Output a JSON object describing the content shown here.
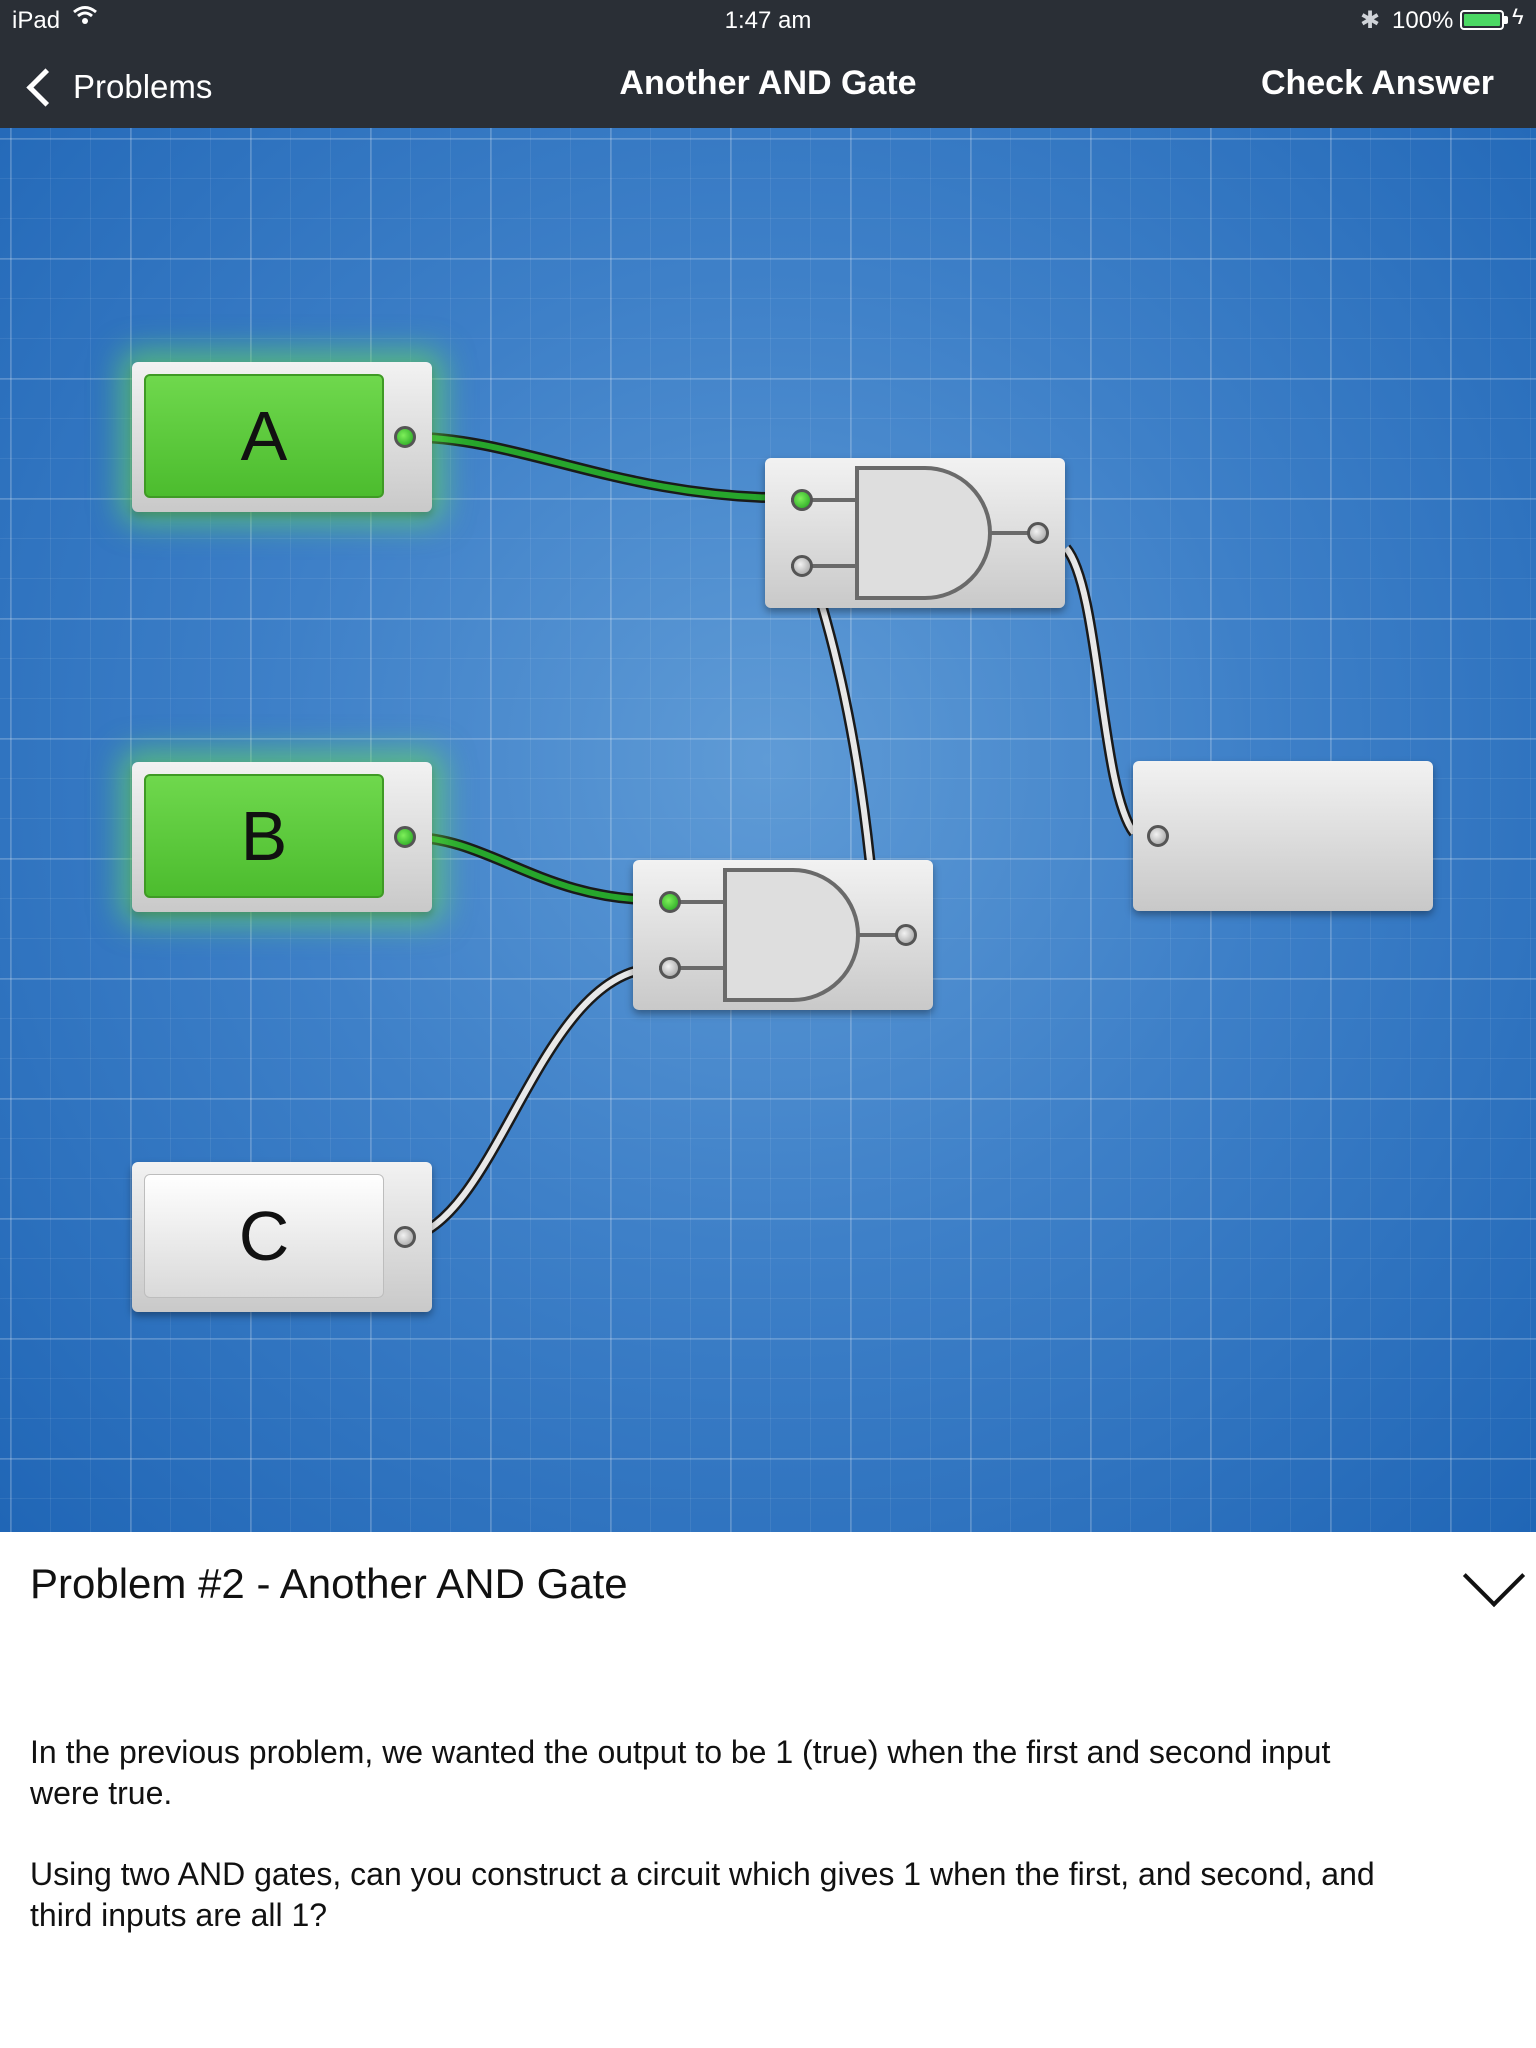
{
  "status_bar": {
    "carrier": "iPad",
    "time": "1:47 am",
    "battery_percent": "100%"
  },
  "nav": {
    "back_label": "Problems",
    "title": "Another AND Gate",
    "check_label": "Check Answer"
  },
  "circuit": {
    "inputs": [
      {
        "label": "A",
        "state": "on"
      },
      {
        "label": "B",
        "state": "on"
      },
      {
        "label": "C",
        "state": "off"
      }
    ],
    "gates": [
      {
        "type": "AND",
        "id": "gate-1"
      },
      {
        "type": "AND",
        "id": "gate-2"
      }
    ],
    "output": {
      "label": ""
    }
  },
  "panel": {
    "title": "Problem #2 - Another AND Gate",
    "paragraphs": [
      "In the previous problem, we wanted the output to be 1 (true) when the first and second input were true.",
      "Using two AND gates, can you construct a circuit which gives 1 when the first, and second, and third inputs are all 1?"
    ]
  },
  "colors": {
    "nav_bg": "#2a2f36",
    "canvas_blue": "#3e80c8",
    "switch_on": "#5ccb3b",
    "wire_on": "#1f9a27"
  }
}
